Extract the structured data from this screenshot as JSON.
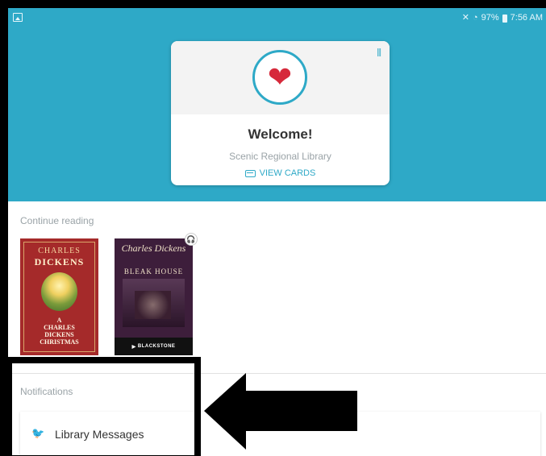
{
  "status_bar": {
    "battery": "97%",
    "time": "7:56 AM"
  },
  "welcome_card": {
    "title": "Welcome!",
    "library_name": "Scenic Regional Library",
    "view_cards_label": "VIEW CARDS"
  },
  "continue_reading": {
    "heading": "Continue reading",
    "books": [
      {
        "cover_author_first": "CHARLES",
        "cover_author_last": "DICKENS",
        "cover_title_lines": [
          "A",
          "CHARLES",
          "DICKENS",
          "CHRISTMAS"
        ]
      },
      {
        "cover_author": "Charles Dickens",
        "cover_title": "BLEAK HOUSE",
        "publisher": "BLACKSTONE"
      }
    ]
  },
  "notifications": {
    "heading": "Notifications",
    "items": [
      {
        "label": "Library Messages",
        "icon": "twitter-icon"
      }
    ]
  },
  "colors": {
    "accent": "#2ea9c7",
    "heart": "#d6293b",
    "twitter": "#1da1f2"
  }
}
